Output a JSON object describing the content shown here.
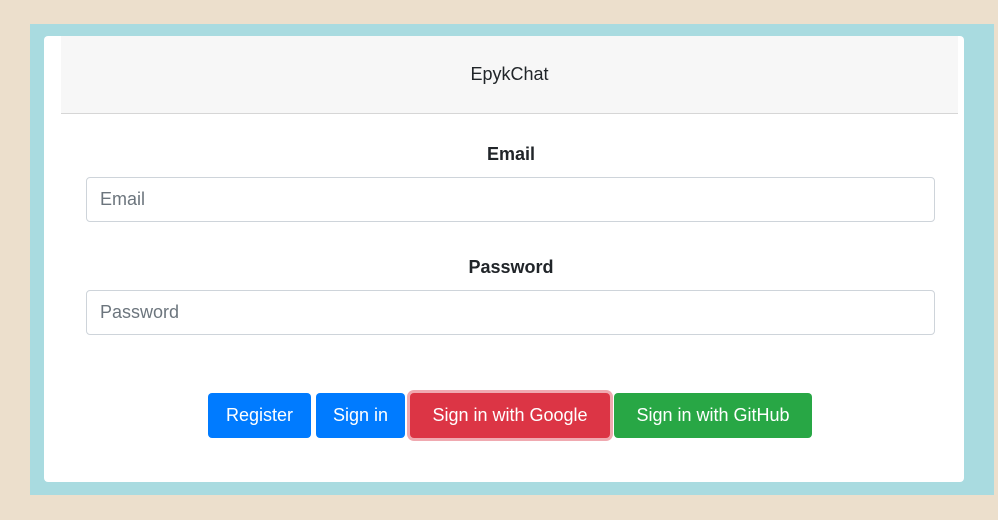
{
  "header": {
    "title": "EpykChat"
  },
  "form": {
    "email": {
      "label": "Email",
      "placeholder": "Email",
      "value": ""
    },
    "password": {
      "label": "Password",
      "placeholder": "Password",
      "value": ""
    }
  },
  "buttons": {
    "register": "Register",
    "sign_in": "Sign in",
    "google": "Sign in with Google",
    "github": "Sign in with GitHub"
  },
  "colors": {
    "background": "#ecdfcc",
    "frame": "#a9dbe0",
    "primary": "#007bff",
    "danger": "#dc3545",
    "success": "#28a745"
  }
}
